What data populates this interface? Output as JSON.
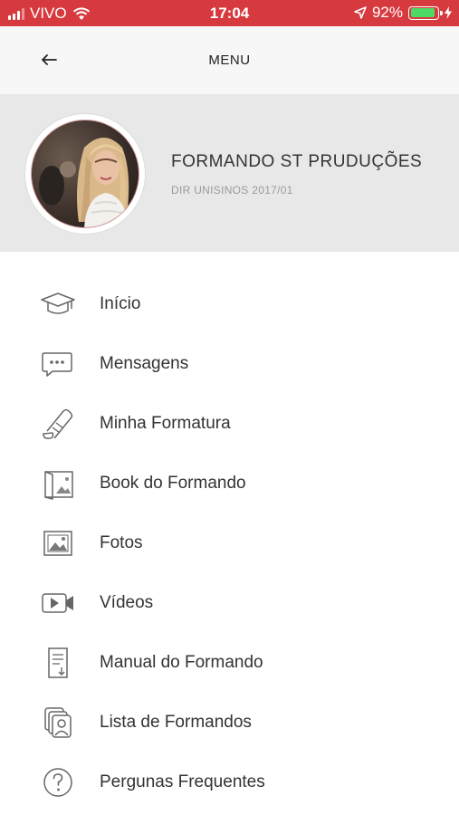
{
  "status": {
    "carrier": "VIVO",
    "time": "17:04",
    "battery": "92%",
    "battery_level": 0.92
  },
  "header": {
    "title": "MENU"
  },
  "profile": {
    "name": "FORMANDO ST PRUDUÇÕES",
    "subtitle": "DIR UNISINOS 2017/01"
  },
  "menu": {
    "items": [
      {
        "label": "Início",
        "icon": "graduation-cap-icon"
      },
      {
        "label": "Mensagens",
        "icon": "chat-bubble-icon"
      },
      {
        "label": "Minha Formatura",
        "icon": "diploma-icon"
      },
      {
        "label": "Book do Formando",
        "icon": "photo-book-icon"
      },
      {
        "label": "Fotos",
        "icon": "image-icon"
      },
      {
        "label": "Vídeos",
        "icon": "video-camera-icon"
      },
      {
        "label": "Manual do Formando",
        "icon": "document-download-icon"
      },
      {
        "label": "Lista de Formandos",
        "icon": "contacts-list-icon"
      },
      {
        "label": "Pergunas Frequentes",
        "icon": "question-circle-icon"
      }
    ]
  }
}
